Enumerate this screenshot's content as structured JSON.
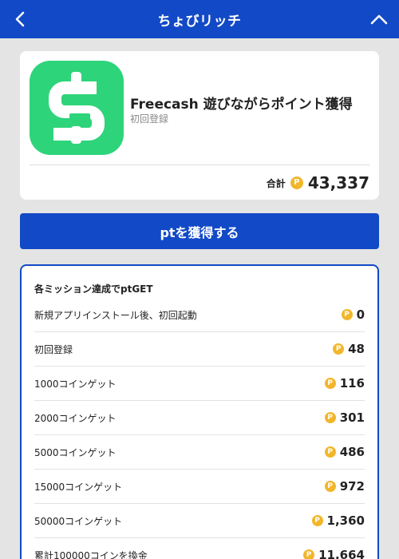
{
  "header": {
    "title": "ちょびリッチ",
    "back_icon": "chevron-left-icon",
    "collapse_icon": "chevron-up-icon",
    "background": "#1249c6"
  },
  "app": {
    "name": "Freecash 遊びながらポイント獲得",
    "subtitle": "初回登録",
    "icon": "freecash-logo-icon",
    "icon_color": "#2ed47a",
    "total_label": "合計",
    "total_value": "43,337",
    "coin_glyph": "P"
  },
  "action": {
    "label": "ptを獲得する"
  },
  "missions": {
    "heading": "各ミッション達成でptGET",
    "items": [
      {
        "label": "新規アプリインストール後、初回起動",
        "value": "0"
      },
      {
        "label": "初回登録",
        "value": "48"
      },
      {
        "label": "1000コインゲット",
        "value": "116"
      },
      {
        "label": "2000コインゲット",
        "value": "301"
      },
      {
        "label": "5000コインゲット",
        "value": "486"
      },
      {
        "label": "15000コインゲット",
        "value": "972"
      },
      {
        "label": "50000コインゲット",
        "value": "1,360"
      },
      {
        "label": "累計100000コインを換金",
        "value": "11,664"
      }
    ]
  },
  "colors": {
    "accent": "#1249c6",
    "coin": "#f2b62c",
    "background": "#e4e4e4"
  }
}
